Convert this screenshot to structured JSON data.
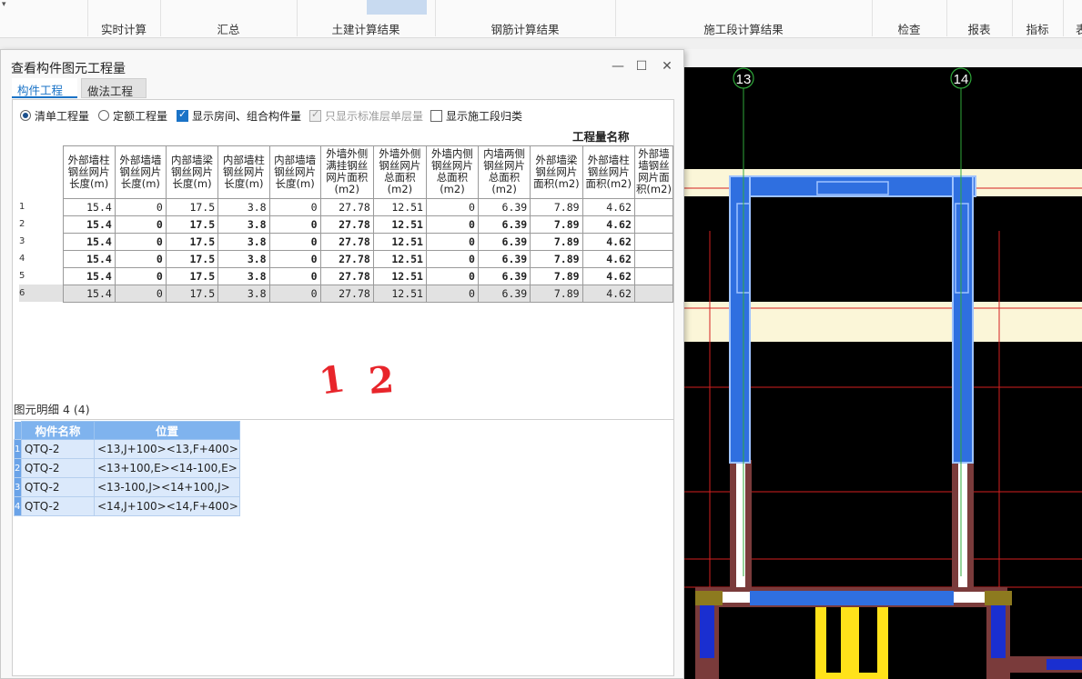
{
  "ribbon": {
    "corner": "▾",
    "groups": [
      "实时计算",
      "汇总",
      "土建计算结果",
      "钢筋计算结果",
      "施工段计算结果",
      "检查",
      "报表",
      "指标",
      "表"
    ]
  },
  "dialog": {
    "title": "查看构件图元工程量",
    "minimize": "—",
    "maximize": "☐",
    "close": "✕",
    "tabs": [
      {
        "label": "构件工程量",
        "active": true
      },
      {
        "label": "做法工程量",
        "active": false
      }
    ],
    "options": [
      {
        "label": "清单工程量",
        "type": "radio",
        "checked": true
      },
      {
        "label": "定额工程量",
        "type": "radio",
        "checked": false
      },
      {
        "label": "显示房间、组合构件量",
        "type": "checkbox",
        "checked": true
      },
      {
        "label": "只显示标准层单层量",
        "type": "checkbox",
        "checked": true,
        "disabled": true
      },
      {
        "label": "显示施工段归类",
        "type": "checkbox",
        "checked": false
      }
    ],
    "group_header": "工程量名称",
    "columns": [
      "外部墙柱钢丝网片长度(m)",
      "外部墙墙钢丝网片长度(m)",
      "内部墙梁钢丝网片长度(m)",
      "内部墙柱钢丝网片长度(m)",
      "内部墙墙钢丝网片长度(m)",
      "外墙外侧满挂钢丝网片面积(m2)",
      "外墙外侧钢丝网片总面积(m2)",
      "外墙内侧钢丝网片总面积(m2)",
      "内墙两侧钢丝网片总面积(m2)",
      "外部墙梁钢丝网片面积(m2)",
      "外部墙柱钢丝网片面积(m2)",
      "外部墙墙钢丝网片面积(m2)"
    ],
    "rows": [
      {
        "n": "1",
        "cells": [
          "15.4",
          "0",
          "17.5",
          "3.8",
          "0",
          "27.78",
          "12.51",
          "0",
          "6.39",
          "7.89",
          "4.62",
          ""
        ]
      },
      {
        "n": "2",
        "cells": [
          "15.4",
          "0",
          "17.5",
          "3.8",
          "0",
          "27.78",
          "12.51",
          "0",
          "6.39",
          "7.89",
          "4.62",
          ""
        ]
      },
      {
        "n": "3",
        "cells": [
          "15.4",
          "0",
          "17.5",
          "3.8",
          "0",
          "27.78",
          "12.51",
          "0",
          "6.39",
          "7.89",
          "4.62",
          ""
        ]
      },
      {
        "n": "4",
        "cells": [
          "15.4",
          "0",
          "17.5",
          "3.8",
          "0",
          "27.78",
          "12.51",
          "0",
          "6.39",
          "7.89",
          "4.62",
          ""
        ]
      },
      {
        "n": "5",
        "cells": [
          "15.4",
          "0",
          "17.5",
          "3.8",
          "0",
          "27.78",
          "12.51",
          "0",
          "6.39",
          "7.89",
          "4.62",
          ""
        ]
      },
      {
        "n": "6",
        "cells": [
          "15.4",
          "0",
          "17.5",
          "3.8",
          "0",
          "27.78",
          "12.51",
          "0",
          "6.39",
          "7.89",
          "4.62",
          ""
        ]
      }
    ],
    "annotation": [
      "1",
      "2"
    ],
    "detail_label": "图元明细  4 (4)",
    "detail_columns": [
      "构件名称",
      "位置"
    ],
    "detail_rows": [
      {
        "n": "1",
        "name": "QTQ-2",
        "pos": "<13,J+100><13,F+400>"
      },
      {
        "n": "2",
        "name": "QTQ-2",
        "pos": "<13+100,E><14-100,E>"
      },
      {
        "n": "3",
        "name": "QTQ-2",
        "pos": "<13-100,J><14+100,J>"
      },
      {
        "n": "4",
        "name": "QTQ-2",
        "pos": "<14,J+100><14,F+400>"
      }
    ]
  },
  "canvas": {
    "axis_labels": [
      "13",
      "14"
    ],
    "colors": {
      "bg": "#000000",
      "wall": "#2f6fe0",
      "axis": "#2fa83a",
      "gridline": "#d42020",
      "band": "#fbf6d8",
      "column": "#ffe21a"
    }
  }
}
